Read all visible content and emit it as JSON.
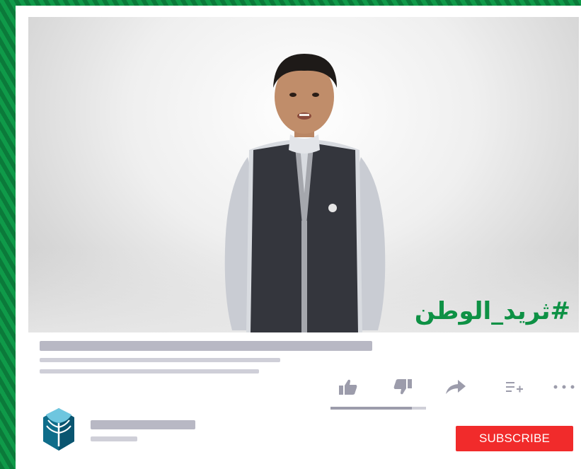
{
  "video": {
    "hashtag": "#ثريد_الوطن",
    "description": "boy in white thobe and dark vest speaking to camera"
  },
  "actions": {
    "like_icon": "thumbs-up-icon",
    "dislike_icon": "thumbs-down-icon",
    "share_icon": "share-arrow-icon",
    "save_icon": "add-to-playlist-icon",
    "more_icon": "more-dots-icon",
    "like_ratio": 0.85
  },
  "channel": {
    "logo_icon": "bank-logo-icon"
  },
  "subscribe": {
    "label": "SUBSCRIBE"
  },
  "colors": {
    "accent": "#f12b2b",
    "hashtag": "#0e9145",
    "skeleton": "#b8b8c4",
    "background_green": "#0b7a3a"
  }
}
